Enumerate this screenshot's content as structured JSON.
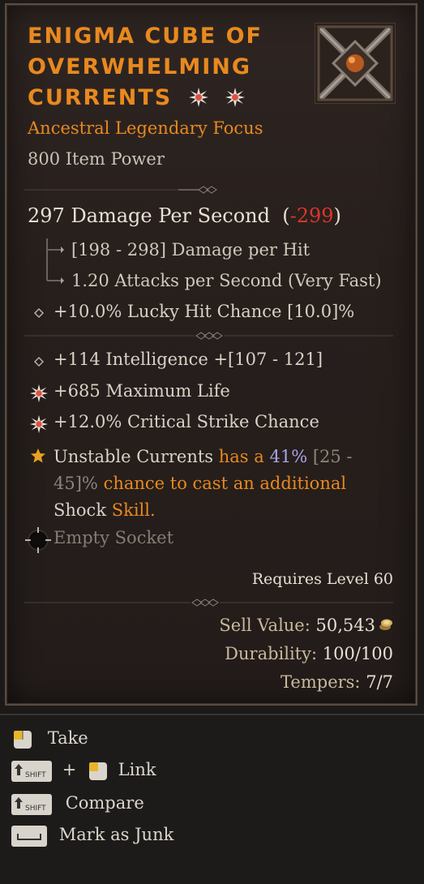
{
  "item": {
    "name": "Enigma Cube of Overwhelming Currents",
    "type": "Ancestral Legendary Focus",
    "item_power": "800 Item Power",
    "dps_main": "297 Damage Per Second",
    "dps_open": "(",
    "dps_delta": "-299",
    "dps_close": ")",
    "damage_per_hit": "[198 - 298] Damage per Hit",
    "attacks_per_second": "1.20 Attacks per Second (Very Fast)",
    "implicit": "+10.0% Lucky Hit Chance [10.0]%",
    "affixes": [
      "+114 Intelligence +[107 - 121]",
      "+685 Maximum Life",
      "+12.0% Critical Strike Chance"
    ],
    "aspect": {
      "name": "Unstable Currents",
      "t1": "has a",
      "value": "41%",
      "range_a": "[25 -",
      "range_b": "45]%",
      "t2": "chance to cast an additional",
      "t3": "Shock",
      "t4": "Skill."
    },
    "socket": "Empty Socket",
    "requires": "Requires Level 60",
    "sell_label": "Sell Value:",
    "sell_value": "50,543",
    "durability_label": "Durability:",
    "durability_value": "100/100",
    "tempers_label": "Tempers:",
    "tempers_value": "7/7"
  },
  "actions": {
    "take": "Take",
    "shift_key": "SHIFT",
    "plus": "+",
    "link": "Link",
    "compare": "Compare",
    "junk": "Mark as Junk"
  },
  "colors": {
    "legendary": "#e8891f",
    "negative": "#d8372a",
    "aspect_value": "#a8a5e8",
    "greater_affix": "#e85040"
  }
}
